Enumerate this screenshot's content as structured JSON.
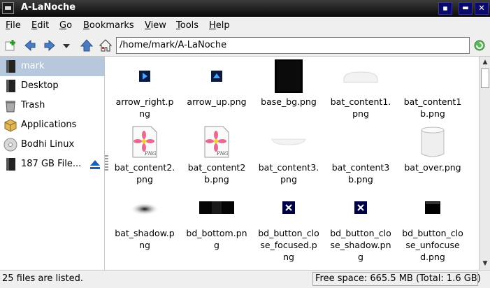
{
  "window": {
    "title": "A-LaNoche"
  },
  "menu": [
    "File",
    "Edit",
    "Go",
    "Bookmarks",
    "View",
    "Tools",
    "Help"
  ],
  "location": {
    "path": "/home/mark/A-LaNoche"
  },
  "sidebar": {
    "items": [
      {
        "label": "mark",
        "icon": "drive-icon",
        "selected": true
      },
      {
        "label": "Desktop",
        "icon": "drive-icon"
      },
      {
        "label": "Trash",
        "icon": "trash-icon"
      },
      {
        "label": "Applications",
        "icon": "applications-icon"
      },
      {
        "label": "Bodhi Linux",
        "icon": "cdrom-icon"
      },
      {
        "label": "187 GB File...",
        "icon": "drive-icon"
      }
    ]
  },
  "files": [
    {
      "name": "arrow_right.png",
      "lines": [
        "arrow_right.p",
        "ng"
      ],
      "thumb": "arrow-right"
    },
    {
      "name": "arrow_up.png",
      "lines": [
        "arrow_up.png"
      ],
      "thumb": "arrow-up"
    },
    {
      "name": "base_bg.png",
      "lines": [
        "base_bg.png"
      ],
      "thumb": "black-tall"
    },
    {
      "name": "bat_content1.png",
      "lines": [
        "bat_content1.",
        "png"
      ],
      "thumb": "white-ellipse"
    },
    {
      "name": "bat_content1b.png",
      "lines": [
        "bat_content1",
        "b.png"
      ],
      "thumb": "blank"
    },
    {
      "name": "bat_content2.png",
      "lines": [
        "bat_content2.",
        "png"
      ],
      "thumb": "png-doc"
    },
    {
      "name": "bat_content2b.png",
      "lines": [
        "bat_content2",
        "b.png"
      ],
      "thumb": "png-doc"
    },
    {
      "name": "bat_content3.png",
      "lines": [
        "bat_content3.",
        "png"
      ],
      "thumb": "white-flat"
    },
    {
      "name": "bat_content3b.png",
      "lines": [
        "bat_content3",
        "b.png"
      ],
      "thumb": "blank"
    },
    {
      "name": "bat_over.png",
      "lines": [
        "bat_over.png"
      ],
      "thumb": "cylinder"
    },
    {
      "name": "bat_shadow.png",
      "lines": [
        "bat_shadow.p",
        "ng"
      ],
      "thumb": "shadow"
    },
    {
      "name": "bd_bottom.png",
      "lines": [
        "bd_bottom.pn",
        "g"
      ],
      "thumb": "black-bar"
    },
    {
      "name": "bd_button_close_focused.png",
      "lines": [
        "bd_button_clo",
        "se_focused.p",
        "ng"
      ],
      "thumb": "close-x"
    },
    {
      "name": "bd_button_close_shadow.png",
      "lines": [
        "bd_button_clo",
        "se_shadow.pn",
        "g"
      ],
      "thumb": "close-x"
    },
    {
      "name": "bd_button_close_unfocused.png",
      "lines": [
        "bd_button_clo",
        "se_unfocuse",
        "d.png"
      ],
      "thumb": "black-square"
    }
  ],
  "status": {
    "left": "25 files are listed.",
    "right": "Free space: 665.5 MB (Total: 1.6 GB)"
  },
  "colors": {
    "selection": "#b7c8dd",
    "titlebar": "#1a1a1a",
    "accent_blue": "#1f5fb4"
  }
}
